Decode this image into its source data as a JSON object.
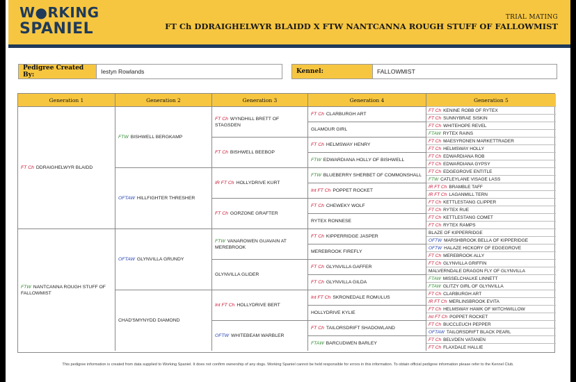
{
  "brand": {
    "line1": "W●RKING",
    "line2": "SPANIEL"
  },
  "header": {
    "subtitle": "TRIAL MATING",
    "title": "FT Ch DDRAIGHELWYR BLAIDD X FTW NANTCANNA ROUGH STUFF OF FALLOWMIST"
  },
  "info": {
    "created_by_label": "Pedigree Created By:",
    "created_by_value": "Iestyn Rowlands",
    "kennel_label": "Kennel:",
    "kennel_value": "FALLOWMIST"
  },
  "generations": [
    "Generation 1",
    "Generation 2",
    "Generation 3",
    "Generation 4",
    "Generation 5"
  ],
  "colors": {
    "accent": "#f7c640",
    "navy": "#1f3a5a",
    "title_red": "#c8102e",
    "title_green": "#2e8b2e",
    "title_blue": "#1f3fb0"
  },
  "g1": [
    {
      "title": "FT Ch",
      "tc": "red",
      "name": "DDRAIGHELWYR BLAIDD"
    },
    {
      "title": "FTW",
      "tc": "green",
      "name": "NANTCANNA ROUGH STUFF OF FALLOWMIST"
    }
  ],
  "g2": [
    {
      "title": "FTW",
      "tc": "green",
      "name": "BISHWELL BERGKAMP"
    },
    {
      "title": "OFTAW",
      "tc": "blue",
      "name": "HILLFIGHTER THRESHER"
    },
    {
      "title": "OFTAW",
      "tc": "blue",
      "name": "GLYNVILLA GRUNDY"
    },
    {
      "title": "",
      "tc": "",
      "name": "CHAD'SMYNYDD DIAMOND"
    }
  ],
  "g3": [
    {
      "title": "FT Ch",
      "tc": "red",
      "name": "WYNDHILL BRETT OF STAGSDEN"
    },
    {
      "title": "FT Ch",
      "tc": "red",
      "name": "BISHWELL BEEBOP"
    },
    {
      "title": "IR FT Ch",
      "tc": "red",
      "name": "HOLLYDRIVE KURT"
    },
    {
      "title": "FT Ch",
      "tc": "red",
      "name": "GORZONE GRAFTER"
    },
    {
      "title": "FTW",
      "tc": "green",
      "name": "VANAROWEN GUAVAIN AT MEREBROOK"
    },
    {
      "title": "",
      "tc": "",
      "name": "GLYNVILLA GLIDER"
    },
    {
      "title": "Int FT Ch",
      "tc": "red",
      "name": "HOLLYDRIVE BERT"
    },
    {
      "title": "OFTW",
      "tc": "blue",
      "name": "WHITEBEAM WARBLER"
    }
  ],
  "g4": [
    {
      "title": "FT Ch",
      "tc": "red",
      "name": "CLARBURGH ART"
    },
    {
      "title": "",
      "tc": "",
      "name": "GLAMOUR GIRL"
    },
    {
      "title": "FT Ch",
      "tc": "red",
      "name": "HELMSWAY HENRY"
    },
    {
      "title": "FTW",
      "tc": "green",
      "name": "EDWARDIANA HOLLY OF BISHWELL"
    },
    {
      "title": "FTW",
      "tc": "green",
      "name": "BLUEBERRY SHERBET OF COMMONSHALL"
    },
    {
      "title": "Int FT Ch",
      "tc": "red",
      "name": "POPPET ROCKET"
    },
    {
      "title": "FT Ch",
      "tc": "red",
      "name": "CHEWEKY WOLF"
    },
    {
      "title": "",
      "tc": "",
      "name": "RYTEX RONNESE"
    },
    {
      "title": "FT Ch",
      "tc": "red",
      "name": "KIPPERRIDGE JASPER"
    },
    {
      "title": "",
      "tc": "",
      "name": "MEREBROOK FIREFLY"
    },
    {
      "title": "FT Ch",
      "tc": "red",
      "name": "GLYNVILLA GAFFER"
    },
    {
      "title": "FT Ch",
      "tc": "red",
      "name": "GLYNVILLA GILDA"
    },
    {
      "title": "Int FT Ch",
      "tc": "red",
      "name": "SKRONEDALE ROMULUS"
    },
    {
      "title": "",
      "tc": "",
      "name": "HOLLYDRIVE KYLIE"
    },
    {
      "title": "FT Ch",
      "tc": "red",
      "name": "TAILORSDRIFT SHADOWLAND"
    },
    {
      "title": "FTAW",
      "tc": "green",
      "name": "BARCUDWEN BARLEY"
    }
  ],
  "g5": [
    {
      "title": "FT Ch",
      "tc": "red",
      "name": "KENINE ROBB OF RYTEX"
    },
    {
      "title": "FT Ch",
      "tc": "red",
      "name": "SUNNYBRAE SISKIN"
    },
    {
      "title": "FT Ch",
      "tc": "red",
      "name": "WHITEHOPE REVEL"
    },
    {
      "title": "FTAW",
      "tc": "green",
      "name": "RYTEX RAINS"
    },
    {
      "title": "FT Ch",
      "tc": "red",
      "name": "MAESYRONEN MARKETTRADER"
    },
    {
      "title": "FT Ch",
      "tc": "red",
      "name": "HELMSWAY HOLLY"
    },
    {
      "title": "FT Ch",
      "tc": "red",
      "name": "EDWARDIANA ROB"
    },
    {
      "title": "FT Ch",
      "tc": "red",
      "name": "EDWARDIANA GYPSY"
    },
    {
      "title": "FT Ch",
      "tc": "red",
      "name": "EDGEGROVE ENTITLE"
    },
    {
      "title": "FTW",
      "tc": "green",
      "name": "CATLEYLANE VISAGE LASS"
    },
    {
      "title": "IR FT Ch",
      "tc": "red",
      "name": "BRAMBLE TAFF"
    },
    {
      "title": "IR FT Ch",
      "tc": "red",
      "name": "LAGANMILL TERN"
    },
    {
      "title": "FT Ch",
      "tc": "red",
      "name": "KETTLESTANG CLIPPER"
    },
    {
      "title": "FT Ch",
      "tc": "red",
      "name": "RYTEX RUE"
    },
    {
      "title": "FT Ch",
      "tc": "red",
      "name": "KETTLESTANG COMET"
    },
    {
      "title": "FT Ch",
      "tc": "red",
      "name": "RYTEX RAMPS"
    },
    {
      "title": "",
      "tc": "",
      "name": "BLAZE OF KIPPERRIDGE"
    },
    {
      "title": "OFTW",
      "tc": "blue",
      "name": "MARSHBROOK BELLA OF KIPPERIDGE"
    },
    {
      "title": "OFTW",
      "tc": "blue",
      "name": "HALAZE HICKORY OF EDGEGROVE"
    },
    {
      "title": "FT Ch",
      "tc": "red",
      "name": "MEREBROOK ALLY"
    },
    {
      "title": "FT Ch",
      "tc": "red",
      "name": "GLYNVILLA GRIFFIN"
    },
    {
      "title": "",
      "tc": "",
      "name": "MALVERNDALE DRAGON FLY OF GLYNVILLA"
    },
    {
      "title": "FTAW",
      "tc": "green",
      "name": "MISSELCHALKE LINNETT"
    },
    {
      "title": "FTAW",
      "tc": "green",
      "name": "GLITZY GIRL OF GLYNVILLA"
    },
    {
      "title": "FT Ch",
      "tc": "red",
      "name": "CLARBURGH ART"
    },
    {
      "title": "IR FT Ch",
      "tc": "red",
      "name": "MERLINSBROOK EVITA"
    },
    {
      "title": "FT Ch",
      "tc": "red",
      "name": "HELMSWAY HAWK OF WITCHWILLOW"
    },
    {
      "title": "Int FT Ch",
      "tc": "red",
      "name": "POPPET ROCKET"
    },
    {
      "title": "FT Ch",
      "tc": "red",
      "name": "BUCCLEUCH PEPPER"
    },
    {
      "title": "OFTAW",
      "tc": "blue",
      "name": "TAILORSDRIFT BLACK PEARL"
    },
    {
      "title": "FT Ch",
      "tc": "red",
      "name": "BELVDEN VATANEN"
    },
    {
      "title": "FT Ch",
      "tc": "red",
      "name": "FLAXDALE HALLIE"
    }
  ],
  "footer": "This pedigree information is created from data supplied to Working Spaniel. It does not confirm ownership of any dogs. Working Spaniel cannot be held responsible for errors in this information. To obtain official pedigree information please refer to the Kennel Club."
}
